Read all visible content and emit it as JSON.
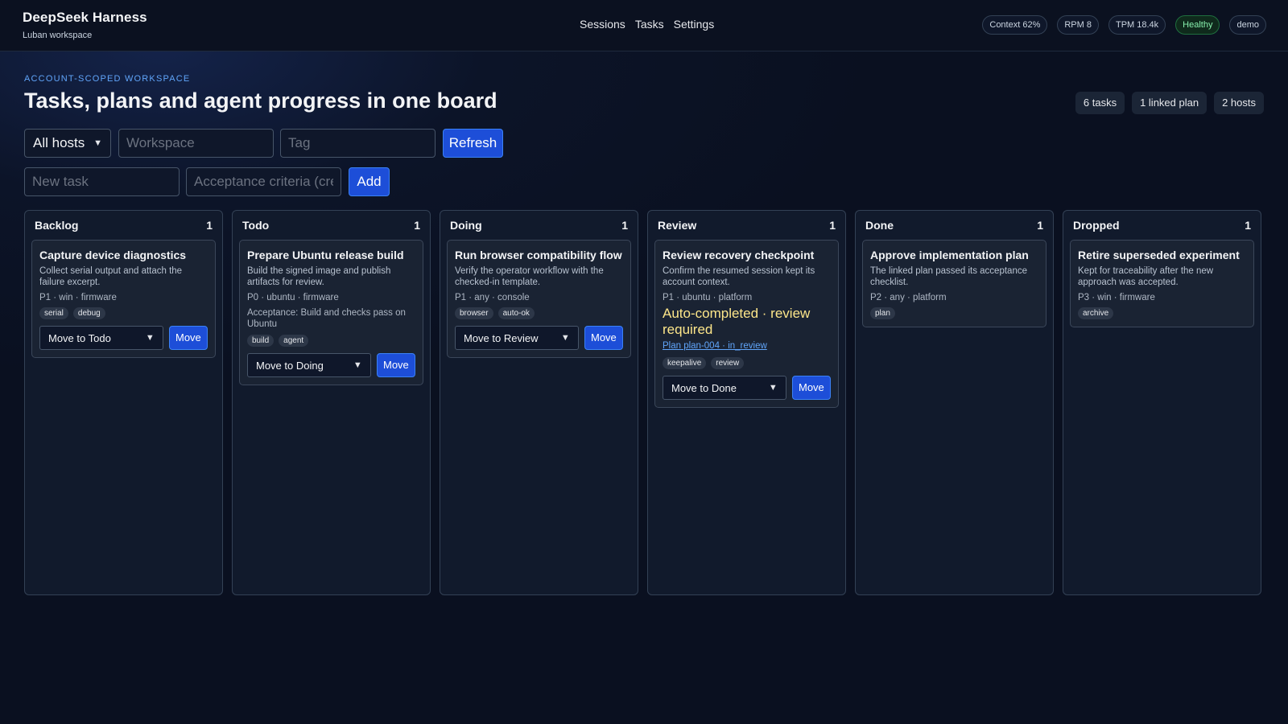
{
  "header": {
    "title": "DeepSeek Harness",
    "subtitle": "Luban workspace",
    "nav": [
      "Sessions",
      "Tasks",
      "Settings"
    ],
    "pills": [
      "Context 62%",
      "RPM 8",
      "TPM 18.4k",
      "Healthy",
      "demo"
    ]
  },
  "hero": {
    "eyebrow": "ACCOUNT-SCOPED WORKSPACE",
    "title": "Tasks, plans and agent progress in one board",
    "stats": [
      "6 tasks",
      "1 linked plan",
      "2 hosts"
    ]
  },
  "filters": {
    "host_value": "All hosts",
    "workspace_placeholder": "Workspace",
    "tag_placeholder": "Tag",
    "refresh_label": "Refresh"
  },
  "new_task": {
    "task_placeholder": "New task",
    "criteria_placeholder": "Acceptance criteria (cre",
    "add_label": "Add"
  },
  "columns": [
    {
      "name": "Backlog",
      "count": "1",
      "card": {
        "title": "Capture device diagnostics",
        "desc": "Collect serial output and attach the failure excerpt.",
        "meta": "P1 · win · firmware",
        "tags": [
          "serial",
          "debug"
        ],
        "move_to": "Move to Todo",
        "move_label": "Move"
      }
    },
    {
      "name": "Todo",
      "count": "1",
      "card": {
        "title": "Prepare Ubuntu release build",
        "desc": "Build the signed image and publish artifacts for review.",
        "meta": "P0 · ubuntu · firmware",
        "acceptance": "Acceptance: Build and checks pass on Ubuntu",
        "tags": [
          "build",
          "agent"
        ],
        "move_to": "Move to Doing",
        "move_label": "Move"
      }
    },
    {
      "name": "Doing",
      "count": "1",
      "card": {
        "title": "Run browser compatibility flow",
        "desc": "Verify the operator workflow with the checked-in template.",
        "meta": "P1 · any · console",
        "tags": [
          "browser",
          "auto-ok"
        ],
        "move_to": "Move to Review",
        "move_label": "Move"
      }
    },
    {
      "name": "Review",
      "count": "1",
      "card": {
        "title": "Review recovery checkpoint",
        "desc": "Confirm the resumed session kept its account context.",
        "meta": "P1 · ubuntu · platform",
        "warning": "Auto-completed · review required",
        "link": "Plan plan-004 · in_review",
        "tags": [
          "keepalive",
          "review"
        ],
        "move_to": "Move to Done",
        "move_label": "Move"
      }
    },
    {
      "name": "Done",
      "count": "1",
      "card": {
        "title": "Approve implementation plan",
        "desc": "The linked plan passed its acceptance checklist.",
        "meta": "P2 · any · platform",
        "tags": [
          "plan"
        ]
      }
    },
    {
      "name": "Dropped",
      "count": "1",
      "card": {
        "title": "Retire superseded experiment",
        "desc": "Kept for traceability after the new approach was accepted.",
        "meta": "P3 · win · firmware",
        "tags": [
          "archive"
        ]
      }
    }
  ]
}
